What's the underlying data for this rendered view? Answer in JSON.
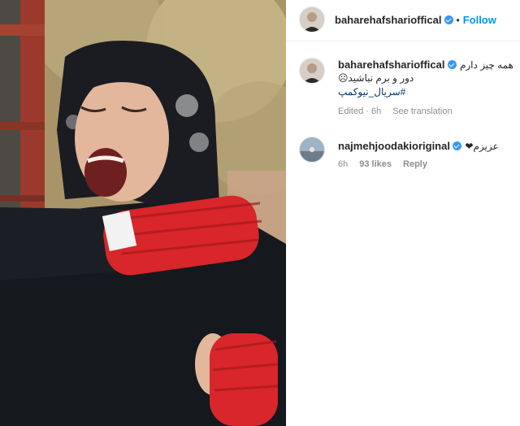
{
  "post_header": {
    "username": "baharehafsharioffical_display",
    "display_username": "baharehafsharioffical",
    "separator": "•",
    "follow_label": "Follow"
  },
  "caption": {
    "username": "baharehafsharioffical",
    "line1": "همه چیز دارم",
    "line2": "دور و برم نباشید☹",
    "hashtag": "#سریال_نیوکمپ",
    "time": "Edited · 6h",
    "see_translation": "See translation"
  },
  "comment": {
    "username": "najmehjoodakioriginal",
    "text": "عزیزم❤",
    "time": "6h",
    "likes": "93 likes",
    "reply": "Reply"
  },
  "colors": {
    "link": "#0095f6",
    "verified": "#3897f0",
    "hashtag": "#00376b",
    "muted": "#8e8e8e",
    "glove": "#d8262a"
  },
  "icons": {
    "verified": "verified-badge-icon",
    "avatar": "avatar"
  }
}
